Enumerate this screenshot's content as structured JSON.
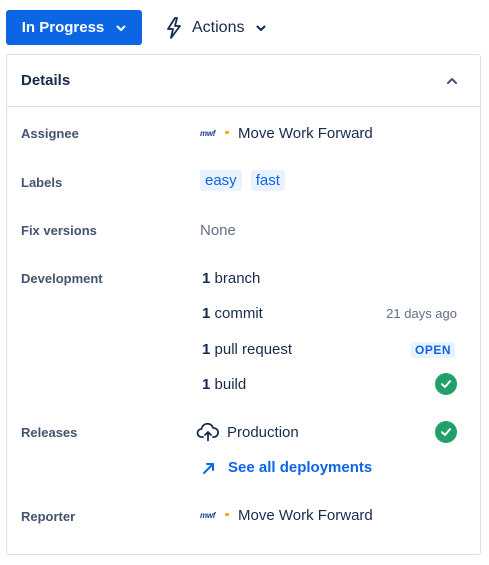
{
  "toolbar": {
    "status_label": "In Progress",
    "actions_label": "Actions"
  },
  "details": {
    "title": "Details",
    "assignee": {
      "label": "Assignee",
      "name": "Move Work Forward",
      "logo_text": "mwf"
    },
    "labels": {
      "label": "Labels",
      "items": [
        "easy",
        "fast"
      ]
    },
    "fix_versions": {
      "label": "Fix versions",
      "value": "None"
    },
    "development": {
      "label": "Development",
      "branch": {
        "count": "1",
        "text": "branch"
      },
      "commit": {
        "count": "1",
        "text": "commit",
        "time": "21 days ago"
      },
      "pull_request": {
        "count": "1",
        "text": "pull request",
        "status": "OPEN"
      },
      "build": {
        "count": "1",
        "text": "build",
        "status": "success"
      }
    },
    "releases": {
      "label": "Releases",
      "environment": "Production",
      "environment_status": "success",
      "see_all": "See all deployments"
    },
    "reporter": {
      "label": "Reporter",
      "name": "Move Work Forward",
      "logo_text": "mwf"
    }
  },
  "colors": {
    "primary": "#0c66e4",
    "success": "#22a06b",
    "text": "#172b4d",
    "subtle": "#626f86",
    "border": "#dcdfe4"
  }
}
